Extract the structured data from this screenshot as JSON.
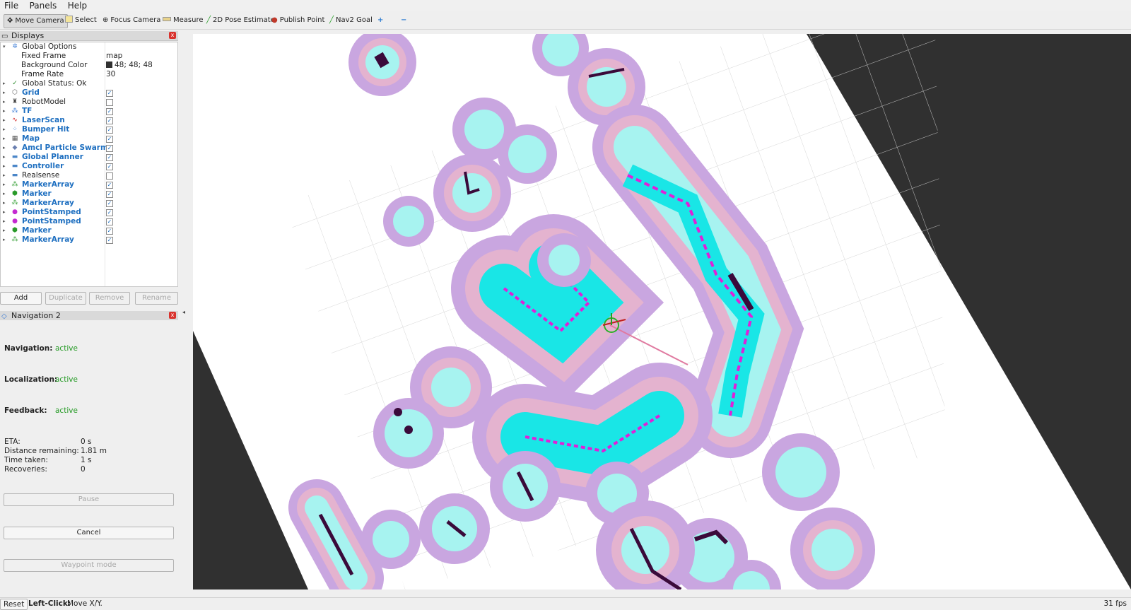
{
  "menubar": {
    "file": "File",
    "panels": "Panels",
    "help": "Help"
  },
  "toolbar": {
    "move_camera": "Move Camera",
    "select": "Select",
    "focus_camera": "Focus Camera",
    "measure": "Measure",
    "pose_estimate": "2D Pose Estimate",
    "publish_point": "Publish Point",
    "nav2_goal": "Nav2 Goal",
    "plus": "+",
    "minus": "−"
  },
  "displays": {
    "title": "Displays",
    "close": "x",
    "global_options": "Global Options",
    "fixed_frame_label": "Fixed Frame",
    "fixed_frame_value": "map",
    "background_color_label": "Background Color",
    "background_color_value": "48; 48; 48",
    "frame_rate_label": "Frame Rate",
    "frame_rate_value": "30",
    "global_status": "Global Status: Ok",
    "items": [
      {
        "label": "Grid",
        "checked": "✓",
        "icon": "grid-icon"
      },
      {
        "label": "RobotModel",
        "checked": "",
        "icon": "robot-icon"
      },
      {
        "label": "TF",
        "checked": "✓",
        "icon": "tf-icon"
      },
      {
        "label": "LaserScan",
        "checked": "✓",
        "icon": "laserscan-icon"
      },
      {
        "label": "Bumper Hit",
        "checked": "✓",
        "icon": "bumper-icon"
      },
      {
        "label": "Map",
        "checked": "✓",
        "icon": "map-icon"
      },
      {
        "label": "Amcl Particle Swarm",
        "checked": "✓",
        "icon": "particle-icon"
      },
      {
        "label": "Global Planner",
        "checked": "✓",
        "icon": "folder-icon"
      },
      {
        "label": "Controller",
        "checked": "✓",
        "icon": "folder-icon"
      },
      {
        "label": "Realsense",
        "checked": "",
        "icon": "folder-icon"
      },
      {
        "label": "MarkerArray",
        "checked": "✓",
        "icon": "markerarray-icon"
      },
      {
        "label": "Marker",
        "checked": "✓",
        "icon": "marker-icon"
      },
      {
        "label": "MarkerArray",
        "checked": "✓",
        "icon": "markerarray-icon"
      },
      {
        "label": "PointStamped",
        "checked": "✓",
        "icon": "point-icon"
      },
      {
        "label": "PointStamped",
        "checked": "✓",
        "icon": "point-icon"
      },
      {
        "label": "Marker",
        "checked": "✓",
        "icon": "marker-icon"
      },
      {
        "label": "MarkerArray",
        "checked": "✓",
        "icon": "markerarray-icon"
      }
    ],
    "buttons": {
      "add": "Add",
      "duplicate": "Duplicate",
      "remove": "Remove",
      "rename": "Rename"
    }
  },
  "navigation": {
    "title": "Navigation 2",
    "close": "x",
    "navigation_label": "Navigation:",
    "navigation_value": "active",
    "localization_label": "Localization:",
    "localization_value": "active",
    "feedback_label": "Feedback:",
    "feedback_value": "active",
    "eta_label": "ETA:",
    "eta_value": "0 s",
    "distance_label": "Distance remaining:",
    "distance_value": "1.81 m",
    "time_label": "Time taken:",
    "time_value": "1 s",
    "recoveries_label": "Recoveries:",
    "recoveries_value": "0",
    "pause": "Pause",
    "cancel": "Cancel",
    "waypoint": "Waypoint mode"
  },
  "statusbar": {
    "reset": "Reset",
    "hint_bold": "Left-Click:",
    "hint": "Move X/Y.",
    "fps": "31 fps"
  },
  "colors": {
    "background": "#303030",
    "free_space": "#ffffff",
    "inflation_outer": "#c9a6e0",
    "inflation_mid": "#e4b3cf",
    "inflation_inner": "#a7f3f0",
    "lethal": "#3a0a3a",
    "costmap_cyan": "#19e6e6",
    "costmap_magenta": "#e020d8"
  }
}
